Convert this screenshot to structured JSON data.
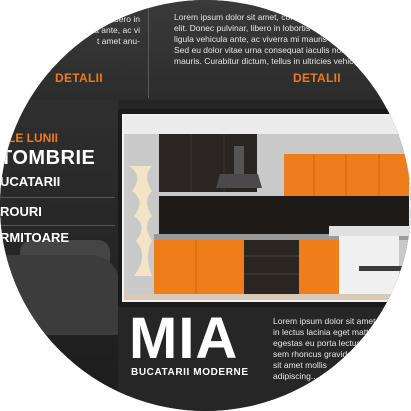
{
  "top": {
    "left_text": "elit. Donec pulvinar, libero in\nligula vehicula ante, ac vi\nt amet anu-",
    "right_text": "Lorem ipsum dolor sit amet, conse\nelit. Donec pulvinar, libero in lobortis orna\nligula vehicula ante, ac viverra mi mauris a ma\nSed eu dolor vitae urna consequat iaculis non eges\nmauris. Curabitur dictum, tellus in ultricies vehicula,",
    "detalii_left": "DETALII",
    "detalii_right": "DETALII"
  },
  "menu": {
    "header": "ELE LUNII",
    "month": "TOMBRIE",
    "items": [
      "UCATARII",
      "ROURI",
      "RMITOARE"
    ]
  },
  "brand": {
    "name": "MIA",
    "subtitle": "BUCATARII MODERNE"
  },
  "bottom_text": "Lorem ipsum dolor sit amet, co\nin lectus lacinia eget mattis\negestas eu porta lectus\nsem rhoncus gravida\nsit amet mollis\nadipiscing...",
  "colors": {
    "accent": "#f07b15",
    "background": "#262626",
    "text": "#ffffff"
  }
}
